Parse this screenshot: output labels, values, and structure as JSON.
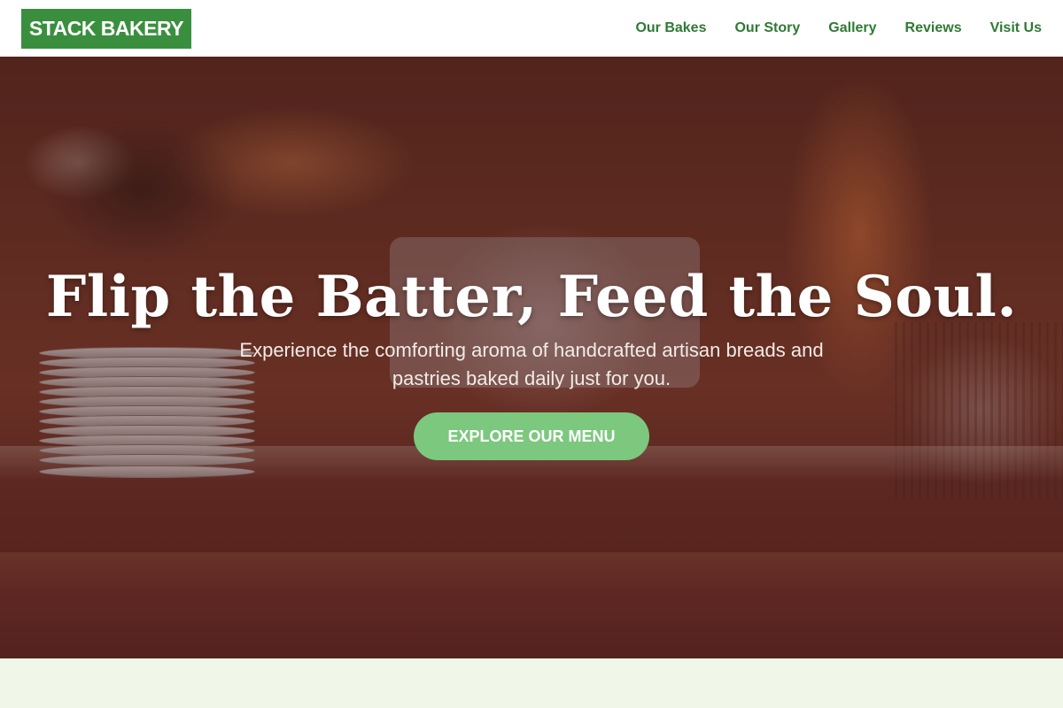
{
  "header": {
    "logo": "STACK BAKERY",
    "nav": [
      {
        "label": "Our Bakes"
      },
      {
        "label": "Our Story"
      },
      {
        "label": "Gallery"
      },
      {
        "label": "Reviews"
      },
      {
        "label": "Visit Us"
      }
    ]
  },
  "hero": {
    "title": "Flip the Batter, Feed the Soul.",
    "subtitle": "Experience the comforting aroma of handcrafted artisan breads and pastries baked daily just for you.",
    "cta_label": "EXPLORE OUR MENU"
  },
  "colors": {
    "brand_green": "#3a8f3f",
    "nav_green": "#2f7a34",
    "cta_green": "#7cc87e",
    "section_bg": "#f0f7e8"
  }
}
